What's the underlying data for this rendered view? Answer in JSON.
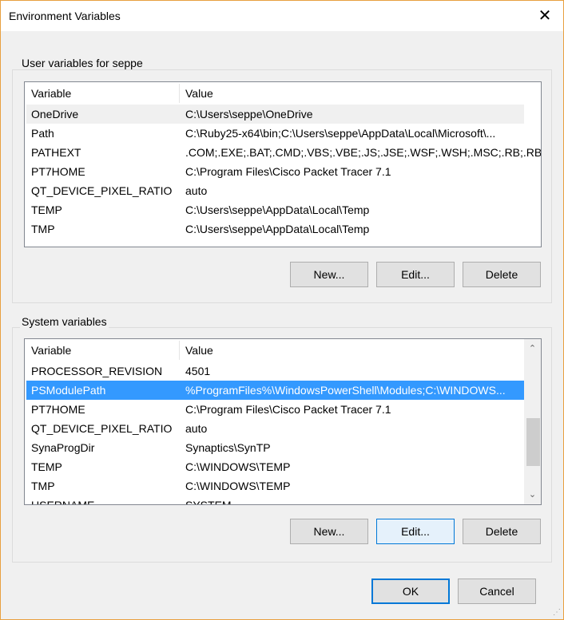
{
  "window": {
    "title": "Environment Variables",
    "close": "✕"
  },
  "user": {
    "label": "User variables for seppe",
    "columns": [
      "Variable",
      "Value"
    ],
    "rows": [
      {
        "variable": "OneDrive",
        "value": "C:\\Users\\seppe\\OneDrive"
      },
      {
        "variable": "Path",
        "value": "C:\\Ruby25-x64\\bin;C:\\Users\\seppe\\AppData\\Local\\Microsoft\\..."
      },
      {
        "variable": "PATHEXT",
        "value": ".COM;.EXE;.BAT;.CMD;.VBS;.VBE;.JS;.JSE;.WSF;.WSH;.MSC;.RB;.RB..."
      },
      {
        "variable": "PT7HOME",
        "value": "C:\\Program Files\\Cisco Packet Tracer 7.1"
      },
      {
        "variable": "QT_DEVICE_PIXEL_RATIO",
        "value": "auto"
      },
      {
        "variable": "TEMP",
        "value": "C:\\Users\\seppe\\AppData\\Local\\Temp"
      },
      {
        "variable": "TMP",
        "value": "C:\\Users\\seppe\\AppData\\Local\\Temp"
      }
    ],
    "buttons": {
      "new": "New...",
      "edit": "Edit...",
      "delete": "Delete"
    }
  },
  "system": {
    "label": "System variables",
    "columns": [
      "Variable",
      "Value"
    ],
    "rows": [
      {
        "variable": "PROCESSOR_REVISION",
        "value": "4501"
      },
      {
        "variable": "PSModulePath",
        "value": "%ProgramFiles%\\WindowsPowerShell\\Modules;C:\\WINDOWS..."
      },
      {
        "variable": "PT7HOME",
        "value": "C:\\Program Files\\Cisco Packet Tracer 7.1"
      },
      {
        "variable": "QT_DEVICE_PIXEL_RATIO",
        "value": "auto"
      },
      {
        "variable": "SynaProgDir",
        "value": "Synaptics\\SynTP"
      },
      {
        "variable": "TEMP",
        "value": "C:\\WINDOWS\\TEMP"
      },
      {
        "variable": "TMP",
        "value": "C:\\WINDOWS\\TEMP"
      },
      {
        "variable": "USERNAME",
        "value": "SYSTEM"
      }
    ],
    "buttons": {
      "new": "New...",
      "edit": "Edit...",
      "delete": "Delete"
    }
  },
  "footer": {
    "ok": "OK",
    "cancel": "Cancel"
  },
  "colors": {
    "selection": "#3399ff",
    "accent": "#0078d7"
  }
}
